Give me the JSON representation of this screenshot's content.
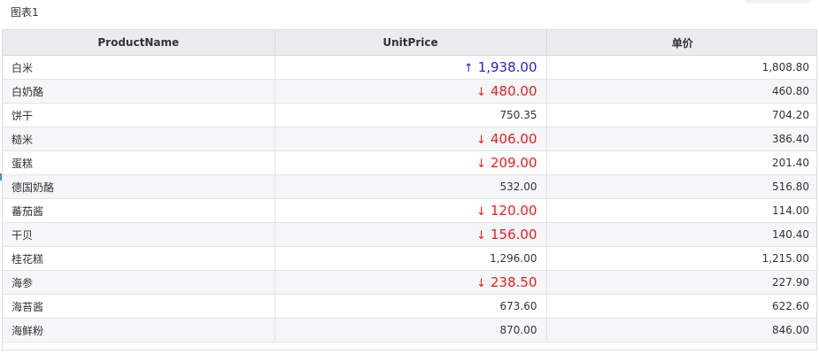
{
  "chart_title": "图表1",
  "columns": {
    "name": "ProductName",
    "unit_price": "UnitPrice",
    "price_cn": "单价"
  },
  "colors": {
    "increase": "#1f1fe0",
    "decrease": "#ee1c1c"
  },
  "rows": [
    {
      "name": "白米",
      "unit_price": "1,938.00",
      "trend": "up",
      "price_cn": "1,808.80"
    },
    {
      "name": "白奶酪",
      "unit_price": "480.00",
      "trend": "down",
      "price_cn": "460.80"
    },
    {
      "name": "饼干",
      "unit_price": "750.35",
      "trend": "none",
      "price_cn": "704.20"
    },
    {
      "name": "糙米",
      "unit_price": "406.00",
      "trend": "down",
      "price_cn": "386.40"
    },
    {
      "name": "蛋糕",
      "unit_price": "209.00",
      "trend": "down",
      "price_cn": "201.40"
    },
    {
      "name": "德国奶酪",
      "unit_price": "532.00",
      "trend": "none",
      "price_cn": "516.80"
    },
    {
      "name": "蕃茄酱",
      "unit_price": "120.00",
      "trend": "down",
      "price_cn": "114.00"
    },
    {
      "name": "干贝",
      "unit_price": "156.00",
      "trend": "down",
      "price_cn": "140.40"
    },
    {
      "name": "桂花糕",
      "unit_price": "1,296.00",
      "trend": "none",
      "price_cn": "1,215.00"
    },
    {
      "name": "海参",
      "unit_price": "238.50",
      "trend": "down",
      "price_cn": "227.90"
    },
    {
      "name": "海苔酱",
      "unit_price": "673.60",
      "trend": "none",
      "price_cn": "622.60"
    },
    {
      "name": "海鲜粉",
      "unit_price": "870.00",
      "trend": "none",
      "price_cn": "846.00"
    }
  ],
  "icons": {
    "up": "↑",
    "down": "↓"
  }
}
